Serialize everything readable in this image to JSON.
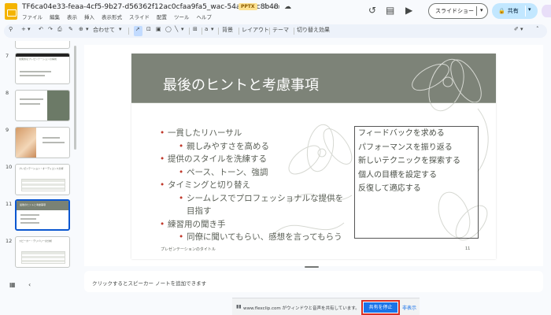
{
  "app": {
    "doc_title": "TF6ca04e33-feaa-4cf5-9b27-d56362f12ac0cfaa9fa5_wac-54af62bc8b48",
    "file_badge": "PPTX",
    "menus": [
      "ファイル",
      "編集",
      "表示",
      "挿入",
      "表示形式",
      "スライド",
      "配置",
      "ツール",
      "ヘルプ"
    ],
    "slideshow_label": "スライドショー",
    "share_label": "共有"
  },
  "toolbar": {
    "zoom_label": "合わせて",
    "background_label": "背景",
    "layout_label": "レイアウト",
    "theme_label": "テーマ",
    "transition_label": "切り替え効果"
  },
  "filmstrip": {
    "slides": [
      {
        "num": "7",
        "kind": "title",
        "text": "効果的なプレゼンテーションの構成"
      },
      {
        "num": "8",
        "kind": "side"
      },
      {
        "num": "9",
        "kind": "image"
      },
      {
        "num": "10",
        "kind": "table",
        "text": "プレゼンテーション・オーディエンス分析"
      },
      {
        "num": "11",
        "kind": "active",
        "text": "最後のヒントと考慮事項"
      },
      {
        "num": "12",
        "kind": "table",
        "text": "スピーカー・デリバリーの分析"
      }
    ]
  },
  "slide": {
    "title": "最後のヒントと考慮事項",
    "bullets": [
      {
        "level": 1,
        "text": "一貫したリハーサル"
      },
      {
        "level": 2,
        "text": "親しみやすさを高める"
      },
      {
        "level": 1,
        "text": "提供のスタイルを洗練する"
      },
      {
        "level": 2,
        "text": "ペース、トーン、強調"
      },
      {
        "level": 1,
        "text": "タイミングと切り替え"
      },
      {
        "level": 2,
        "text": "シームレスでプロフェッショナルな提供を目指す"
      },
      {
        "level": 1,
        "text": "練習用の聞き手"
      },
      {
        "level": 2,
        "text": "同僚に聞いてもらい、感想を言ってもらう"
      }
    ],
    "box_lines": [
      "フィードバックを求める",
      "パフォーマンスを振り返る",
      "新しいテクニックを探索する",
      "個人の目標を設定する",
      "反復して適応する"
    ],
    "footer": "プレゼンテーションのタイトル",
    "page_number": "11"
  },
  "notes": {
    "placeholder": "クリックするとスピーカー ノートを追加できます"
  },
  "sharebar": {
    "message": "www.flexclip.com がウィンドウと音声を共有しています。",
    "stop_label": "共有を停止",
    "hide_label": "非表示"
  }
}
